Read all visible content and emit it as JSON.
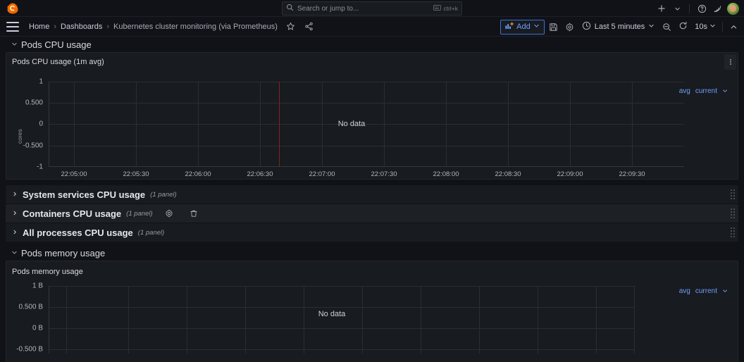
{
  "topbar": {
    "logo_icon": "grafana-logo-icon",
    "search": {
      "icon": "search-icon",
      "placeholder": "Search or jump to...",
      "shortcut_icon": "keyboard-icon",
      "shortcut": "ctrl+k"
    },
    "actions": [
      {
        "name": "new-menu-button",
        "icon": "plus-icon",
        "label": "+"
      },
      {
        "name": "new-menu-chevron",
        "icon": "chevron-down-icon",
        "label": "⌄"
      },
      {
        "name": "help-button",
        "icon": "help-circle-icon",
        "label": "?"
      },
      {
        "name": "news-button",
        "icon": "rss-icon",
        "label": "rss"
      },
      {
        "name": "profile-avatar",
        "icon": "avatar-icon",
        "label": ""
      }
    ]
  },
  "dashbar": {
    "menu_icon": "hamburger-menu-icon",
    "breadcrumb": {
      "home": "Home",
      "dashboards": "Dashboards",
      "current": "Kubernetes cluster monitoring (via Prometheus)",
      "separator": "›",
      "star_icon": "star-icon",
      "share_icon": "share-nodes-icon"
    },
    "add_button": {
      "label": "Add",
      "icon": "panel-add-icon",
      "chevron": "⌄"
    },
    "save_icon": "save-disk-icon",
    "settings_icon": "gear-icon",
    "time_picker": {
      "icon": "clock-icon",
      "label": "Last 5 minutes",
      "chevron": "⌄"
    },
    "zoom_out_icon": "zoom-out-icon",
    "refresh_icon": "refresh-icon",
    "refresh_interval": {
      "label": "10s",
      "chevron": "⌄"
    },
    "collapse_toolbar_icon": "chevron-up-icon"
  },
  "rows": [
    {
      "name": "row-pods-cpu-usage",
      "title": "Pods CPU usage",
      "state": "expanded",
      "chevron": "⌄"
    },
    {
      "name": "row-system-services-cpu-usage",
      "title": "System services CPU usage",
      "panel_count": "(1 panel)",
      "state": "collapsed",
      "chevron": "›",
      "hovered": false
    },
    {
      "name": "row-containers-cpu-usage",
      "title": "Containers CPU usage",
      "panel_count": "(1 panel)",
      "state": "collapsed",
      "chevron": "›",
      "hovered": true,
      "settings_icon": "gear-icon",
      "delete_icon": "trash-icon"
    },
    {
      "name": "row-all-processes-cpu-usage",
      "title": "All processes CPU usage",
      "panel_count": "(1 panel)",
      "state": "collapsed",
      "chevron": "›",
      "hovered": false
    },
    {
      "name": "row-pods-memory-usage",
      "title": "Pods memory usage",
      "state": "expanded",
      "chevron": "⌄"
    }
  ],
  "panels": {
    "pods_cpu": {
      "title": "Pods CPU usage (1m avg)",
      "menu_icon": "panel-menu-kebab-icon",
      "no_data": "No data",
      "legend": {
        "avg": "avg",
        "current": "current",
        "chevron": "⌄"
      }
    },
    "pods_memory": {
      "title": "Pods memory usage",
      "no_data": "No data",
      "legend": {
        "avg": "avg",
        "current": "current",
        "chevron": "⌄"
      }
    }
  },
  "chart_data": [
    {
      "type": "line",
      "name": "pods-cpu-usage-chart",
      "title": "Pods CPU usage (1m avg)",
      "xlabel": "",
      "ylabel": "cores",
      "series": [],
      "state": "No data",
      "ylim": [
        -1,
        1
      ],
      "yticks": [
        "-1",
        "-0.500",
        "0",
        "0.500",
        "1"
      ],
      "ytick_values": [
        -1,
        -0.5,
        0,
        0.5,
        1
      ],
      "x": [
        "22:05:00",
        "22:05:30",
        "22:06:00",
        "22:06:30",
        "22:07:00",
        "22:07:30",
        "22:08:00",
        "22:08:30",
        "22:09:00",
        "22:09:30"
      ],
      "grid": true,
      "legend_position": "right",
      "annotation_line": {
        "color": "#8a1f1f",
        "x": "22:06:38"
      }
    },
    {
      "type": "line",
      "name": "pods-memory-usage-chart",
      "title": "Pods memory usage",
      "xlabel": "",
      "ylabel": "",
      "series": [],
      "state": "No data",
      "ylim": [
        -1,
        1
      ],
      "yticks": [
        "-0.500 B",
        "0 B",
        "0.500 B",
        "1 B"
      ],
      "ytick_values": [
        -0.5,
        0,
        0.5,
        1
      ],
      "x": [],
      "grid": true,
      "legend_position": "right"
    }
  ],
  "colors": {
    "page_bg": "#111217",
    "panel_bg": "#181b1f",
    "border": "#23262b",
    "text": "#ccccdc",
    "muted": "#9a9aa8",
    "accent_blue": "#6e9fff",
    "grid": "#2a2d33",
    "annotation_red": "#8a1f1f"
  }
}
